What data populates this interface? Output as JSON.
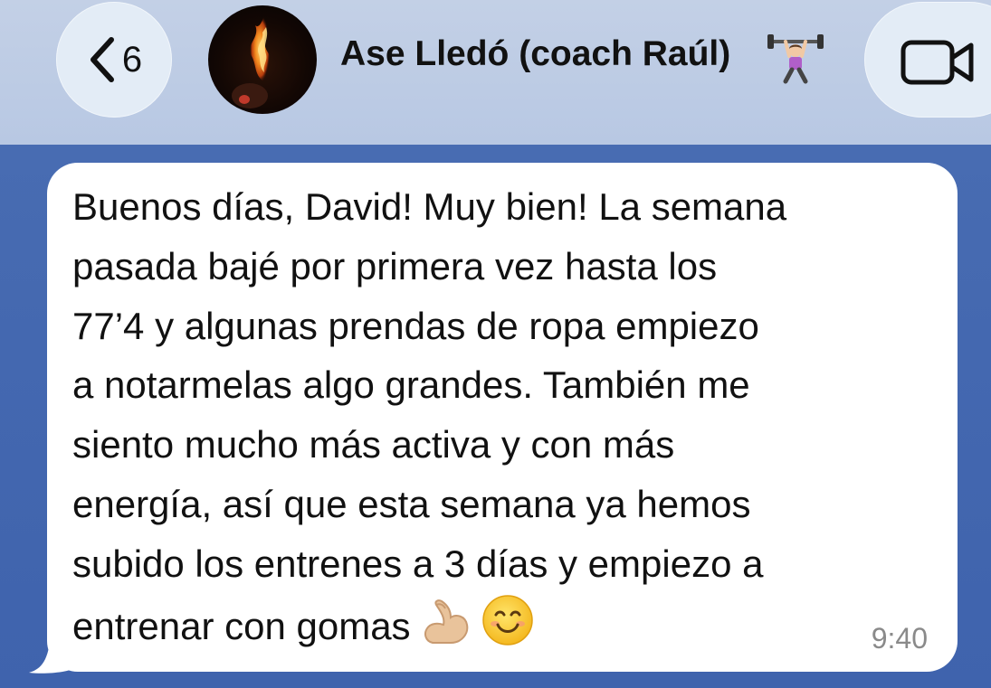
{
  "header": {
    "back_count": "6",
    "contact_name": "Ase Lledó (coach Raúl)",
    "icons": {
      "back": "chevron-left-icon",
      "video": "video-camera-icon",
      "contact_emoji": "weight-lifter-emoji"
    }
  },
  "message": {
    "lines": [
      "Buenos días, David! Muy bien! La semana",
      "pasada bajé por primera vez hasta los",
      "77’4 y algunas prendas de ropa empiezo",
      "a notarmelas algo grandes. También me",
      "siento mucho más activa y con más",
      "energía, así que esta semana ya hemos",
      "subido los entrenes a 3 días y empiezo a",
      "entrenar con gomas"
    ],
    "emojis": [
      "flexed-biceps-emoji",
      "smiling-face-emoji"
    ],
    "time": "9:40"
  },
  "colors": {
    "header_bg": "#bccbe4",
    "chat_bg": "#4468b0",
    "bubble_bg": "#ffffff",
    "timestamp": "#8a8a8a"
  }
}
